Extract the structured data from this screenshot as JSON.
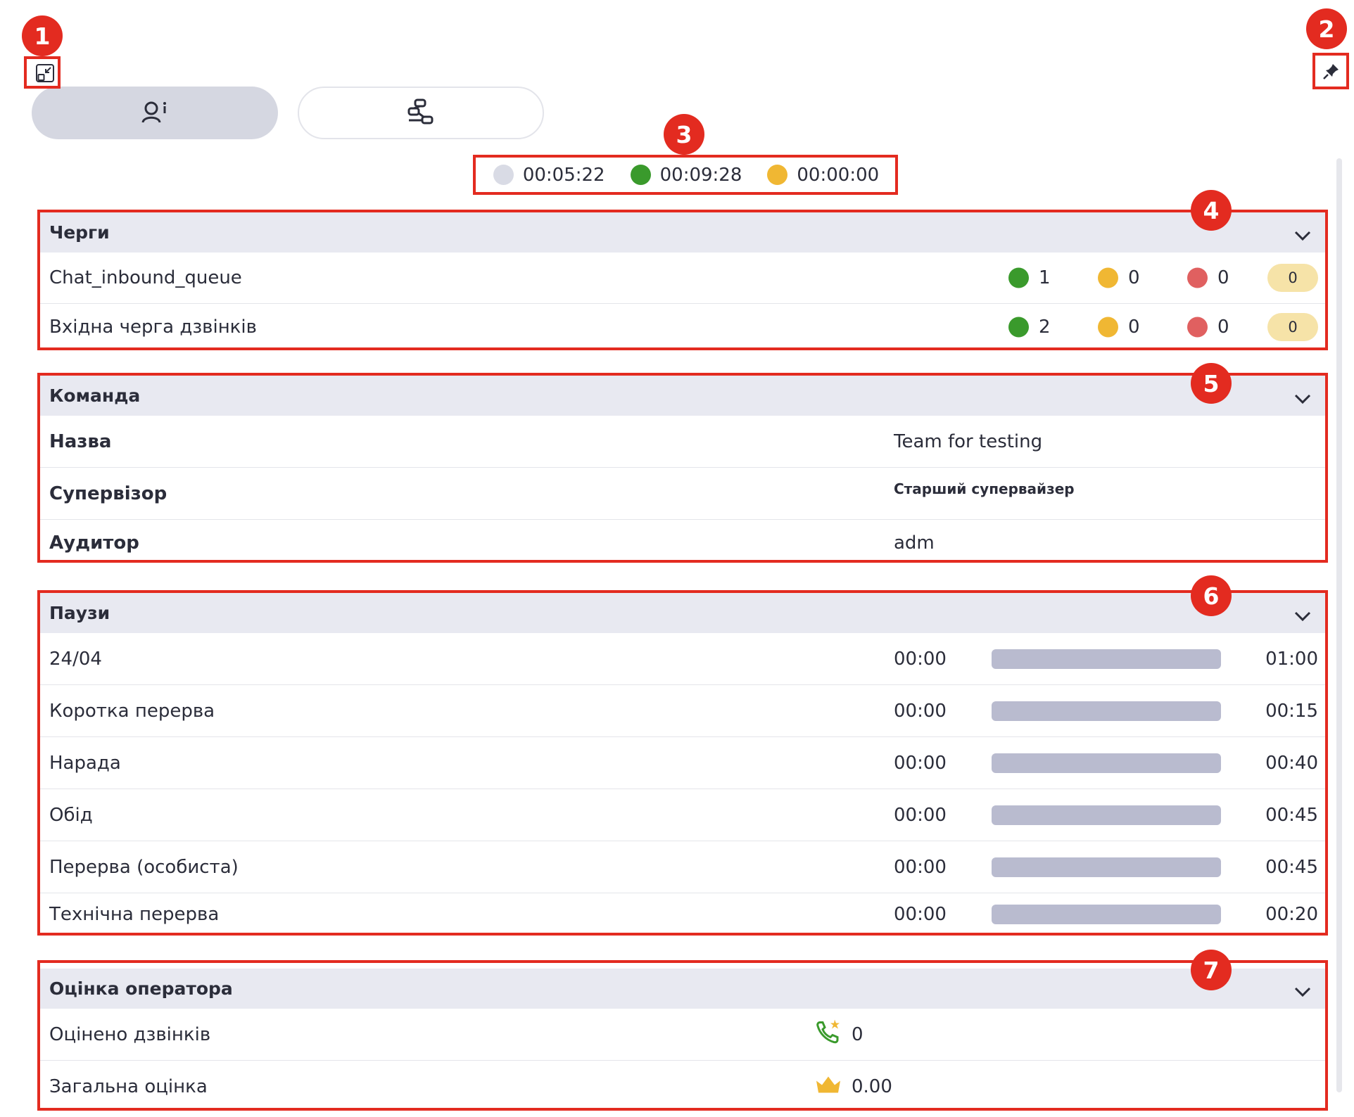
{
  "top": {
    "collapse_icon": "collapse-window-icon",
    "pin_icon": "pin-icon"
  },
  "tabs": [
    {
      "icon": "operator-info-icon",
      "active": true
    },
    {
      "icon": "workflow-icon",
      "active": false
    }
  ],
  "timers": [
    {
      "color": "#d9dbe5",
      "value": "00:05:22"
    },
    {
      "color": "#3a9a2c",
      "value": "00:09:28"
    },
    {
      "color": "#f0b733",
      "value": "00:00:00"
    }
  ],
  "queues": {
    "title": "Черги",
    "rows": [
      {
        "name": "Chat_inbound_queue",
        "green": "1",
        "yellow": "0",
        "red": "0",
        "total": "0"
      },
      {
        "name": "Вхідна черга дзвінків",
        "green": "2",
        "yellow": "0",
        "red": "0",
        "total": "0"
      }
    ]
  },
  "team": {
    "title": "Команда",
    "rows": [
      {
        "label": "Назва",
        "value": "Team for testing"
      },
      {
        "label": "Супервізор",
        "value": "Старший супервайзер"
      },
      {
        "label": "Аудитор",
        "value": "adm"
      }
    ]
  },
  "pauses": {
    "title": "Паузи",
    "rows": [
      {
        "name": "24/04",
        "used": "00:00",
        "limit": "01:00",
        "progress": 0
      },
      {
        "name": "Коротка перерва",
        "used": "00:00",
        "limit": "00:15",
        "progress": 0
      },
      {
        "name": "Нарада",
        "used": "00:00",
        "limit": "00:40",
        "progress": 0
      },
      {
        "name": "Обід",
        "used": "00:00",
        "limit": "00:45",
        "progress": 0
      },
      {
        "name": "Перерва (особиста)",
        "used": "00:00",
        "limit": "00:45",
        "progress": 0
      },
      {
        "name": "Технічна перерва",
        "used": "00:00",
        "limit": "00:20",
        "progress": 0
      }
    ]
  },
  "rating": {
    "title": "Оцінка оператора",
    "rows": [
      {
        "label": "Оцінено дзвінків",
        "icon": "rated-call-icon",
        "value": "0"
      },
      {
        "label": "Загальна оцінка",
        "icon": "crown-icon",
        "value": "0.00"
      }
    ]
  },
  "callouts": [
    "1",
    "2",
    "3",
    "4",
    "5",
    "6",
    "7"
  ],
  "colors": {
    "callout": "#e32b20",
    "header_bg": "#e8e9f1",
    "green": "#3a9a2c",
    "yellow": "#f0b733",
    "red": "#e06060",
    "pill": "#f6e3a8",
    "bar": "#b9bbcf"
  }
}
